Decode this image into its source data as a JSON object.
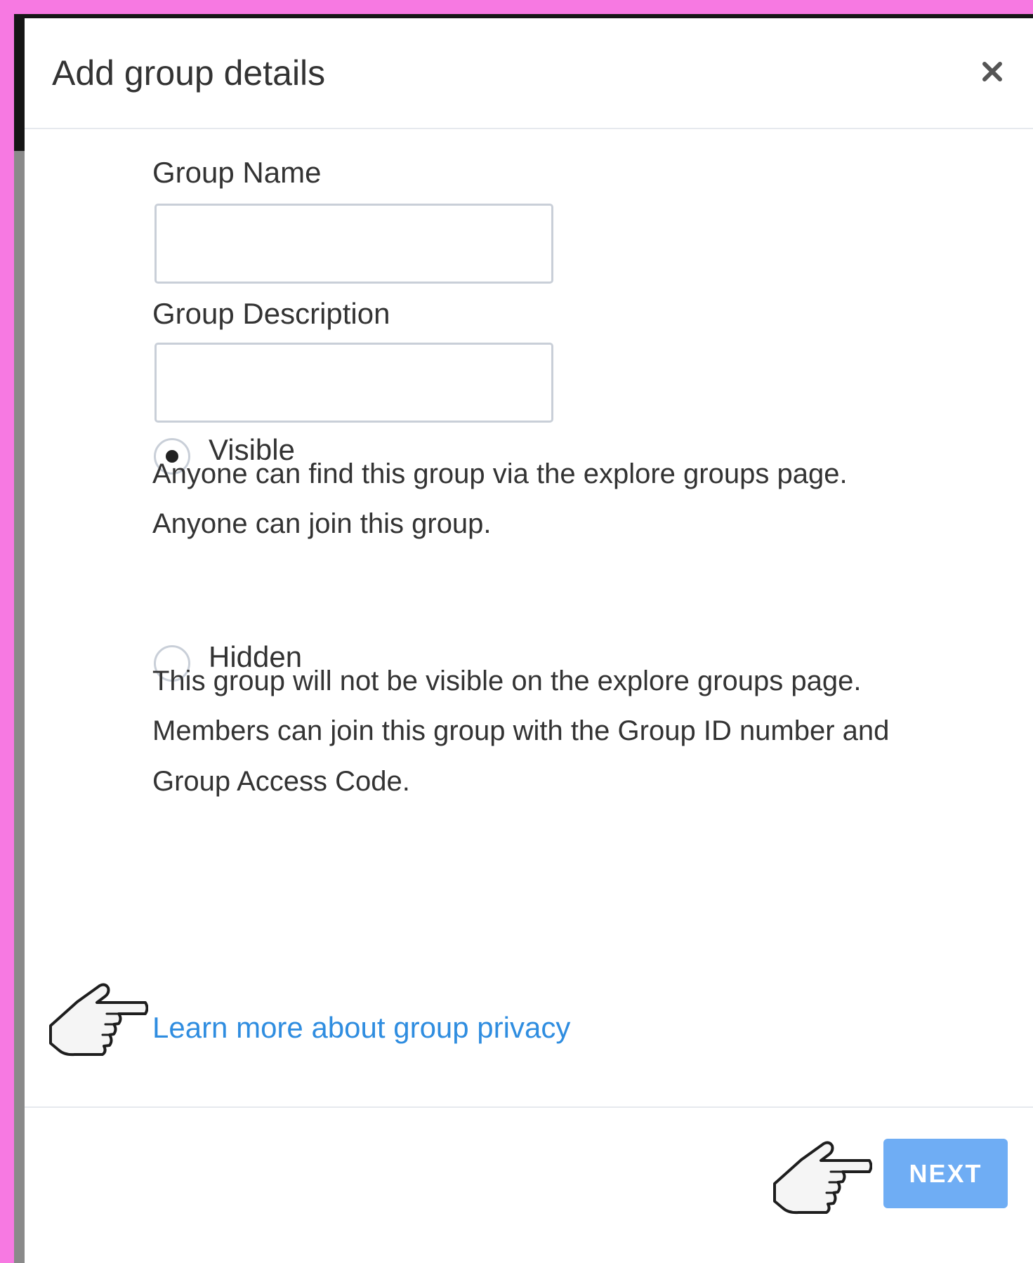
{
  "modal": {
    "title": "Add group details",
    "close_icon": "close-icon",
    "footer": {
      "next_label": "NEXT"
    }
  },
  "form": {
    "group_name": {
      "label": "Group Name",
      "value": ""
    },
    "group_description": {
      "label": "Group Description",
      "value": ""
    },
    "privacy_options": [
      {
        "label": "Visible",
        "selected": true,
        "description_lines": [
          "Anyone can find this group via the explore groups page.",
          "Anyone can join this group."
        ]
      },
      {
        "label": "Hidden",
        "selected": false,
        "description_lines": [
          "This group will not be visible on the explore groups page.",
          "Members can join this group with the Group ID number and",
          "Group Access Code."
        ]
      }
    ],
    "learn_more_link": "Learn more about group privacy"
  },
  "annotations": {
    "pointer_icon": "pointing-hand-icon"
  },
  "colors": {
    "frame": "#f779e2",
    "link": "#2f8de0",
    "primary_button": "#6fadf4",
    "input_border": "#c9cfd8"
  }
}
